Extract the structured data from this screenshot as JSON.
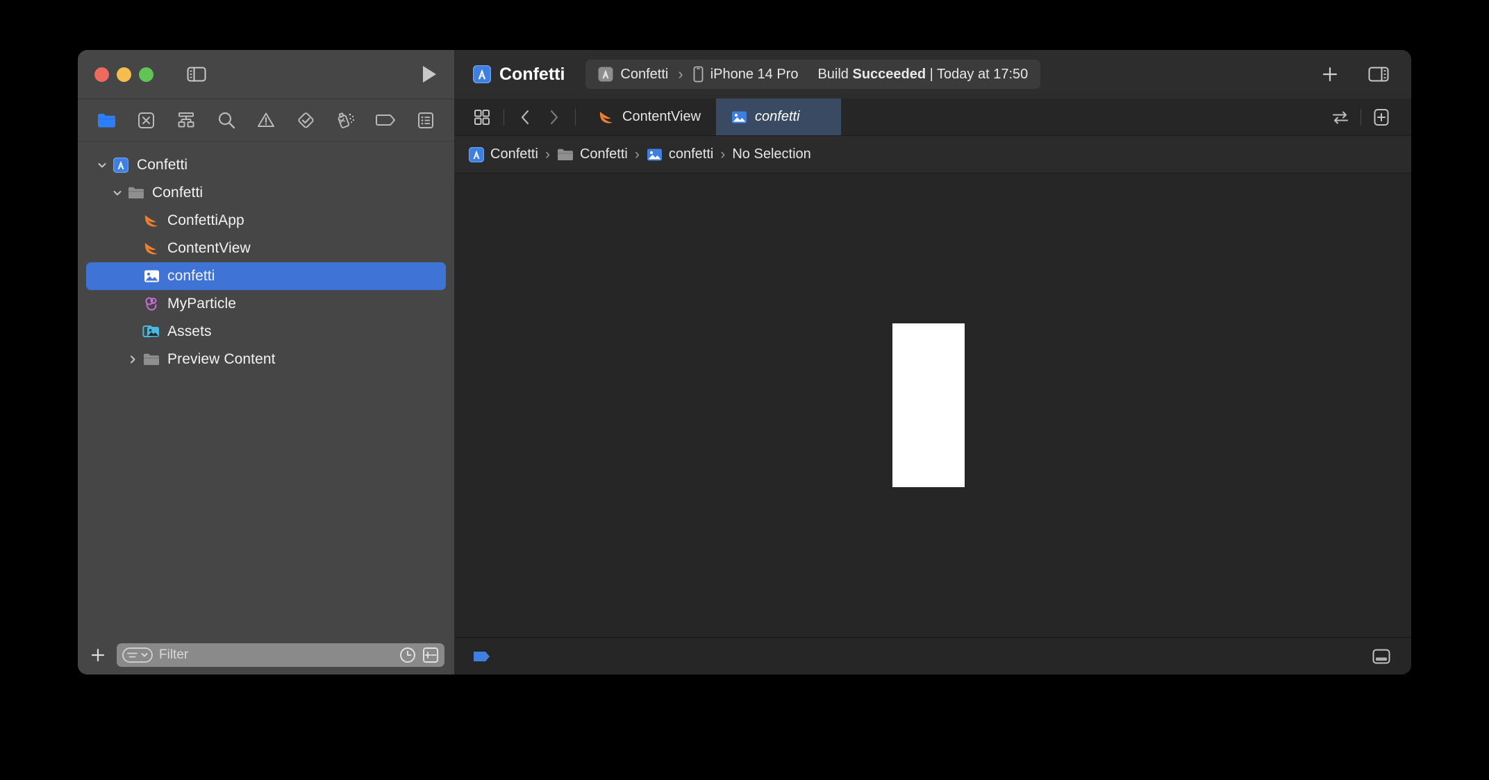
{
  "window": {
    "traffic_lights": [
      "close",
      "minimize",
      "maximize"
    ],
    "sidebar_toggle_icon": "sidebar-left-icon",
    "run_icon": "play-icon"
  },
  "navigator": {
    "toolbar_icons": [
      {
        "name": "project-navigator-icon",
        "label": "Project Navigator",
        "active": true
      },
      {
        "name": "source-control-navigator-icon",
        "label": "Source Control Navigator",
        "active": false
      },
      {
        "name": "hierarchy-navigator-icon",
        "label": "Symbol Navigator",
        "active": false
      },
      {
        "name": "find-navigator-icon",
        "label": "Find Navigator",
        "active": false
      },
      {
        "name": "issue-navigator-icon",
        "label": "Issue Navigator",
        "active": false
      },
      {
        "name": "test-navigator-icon",
        "label": "Test Navigator",
        "active": false
      },
      {
        "name": "debug-navigator-icon",
        "label": "Debug Navigator",
        "active": false
      },
      {
        "name": "breakpoint-navigator-icon",
        "label": "Breakpoint Navigator",
        "active": false
      },
      {
        "name": "report-navigator-icon",
        "label": "Report Navigator",
        "active": false
      }
    ],
    "tree": [
      {
        "label": "Confetti",
        "icon": "app-project-icon",
        "depth": 0,
        "chevron": "down",
        "selected": false
      },
      {
        "label": "Confetti",
        "icon": "folder-icon",
        "depth": 1,
        "chevron": "down",
        "selected": false
      },
      {
        "label": "ConfettiApp",
        "icon": "swift-file-icon",
        "depth": 2,
        "chevron": "none",
        "selected": false
      },
      {
        "label": "ContentView",
        "icon": "swift-file-icon",
        "depth": 2,
        "chevron": "none",
        "selected": false
      },
      {
        "label": "confetti",
        "icon": "image-file-icon",
        "depth": 2,
        "chevron": "none",
        "selected": true
      },
      {
        "label": "MyParticle",
        "icon": "particle-file-icon",
        "depth": 2,
        "chevron": "none",
        "selected": false
      },
      {
        "label": "Assets",
        "icon": "assets-icon",
        "depth": 2,
        "chevron": "none",
        "selected": false
      },
      {
        "label": "Preview Content",
        "icon": "folder-icon",
        "depth": 2,
        "chevron": "right",
        "selected": false
      }
    ],
    "filter_bar": {
      "add_label": "+",
      "add_icon": "plus-icon",
      "filter_scope_icon": "filter-scope-icon",
      "placeholder": "Filter",
      "recent_icon": "clock-icon",
      "source_control_filter_icon": "plus-minus-icon"
    }
  },
  "toolbar": {
    "project_icon": "app-project-icon",
    "project_name": "Confetti",
    "scheme": {
      "scheme_icon": "app-project-icon",
      "scheme_name": "Confetti",
      "separator": "›",
      "device_icon": "iphone-icon",
      "device_name": "iPhone 14 Pro"
    },
    "status_prefix": "Build ",
    "status_result": "Succeeded",
    "status_suffix": " | Today at 17:50",
    "add_button_icon": "plus-icon",
    "inspector_toggle_icon": "sidebar-right-icon"
  },
  "editor": {
    "tab_overview_icon": "tab-overview-icon",
    "back_icon": "chevron-left-icon",
    "forward_icon": "chevron-right-icon",
    "tabs": [
      {
        "label": "ContentView",
        "icon": "swift-file-icon",
        "active": false
      },
      {
        "label": "confetti",
        "icon": "image-file-icon",
        "active": true
      }
    ],
    "swap_editor_icon": "swap-arrows-icon",
    "add_editor_icon": "add-editor-icon",
    "breadcrumb": [
      {
        "label": "Confetti",
        "icon": "app-project-icon"
      },
      {
        "label": "Confetti",
        "icon": "folder-icon"
      },
      {
        "label": "confetti",
        "icon": "image-file-icon"
      },
      {
        "label": "No Selection",
        "icon": "none"
      }
    ],
    "breadcrumb_separator": "›",
    "canvas": {
      "asset_name": "confetti",
      "asset_color": "#ffffff"
    },
    "statusbar": {
      "slicing_icon": "slicing-tag-icon",
      "bottom_panel_icon": "bottom-panel-icon"
    }
  },
  "colors": {
    "window_background": "#000000",
    "navigator_background": "#464646",
    "editor_background": "#262626",
    "titlebar_background": "#2d2d2d",
    "selection_blue": "#3f74d6",
    "active_tab_blue": "#3a4a63",
    "accent_blue": "#3f7fe0",
    "swift_orange": "#f05138",
    "particle_pink": "#cd6ee0",
    "assets_cyan": "#4bb8dd"
  }
}
